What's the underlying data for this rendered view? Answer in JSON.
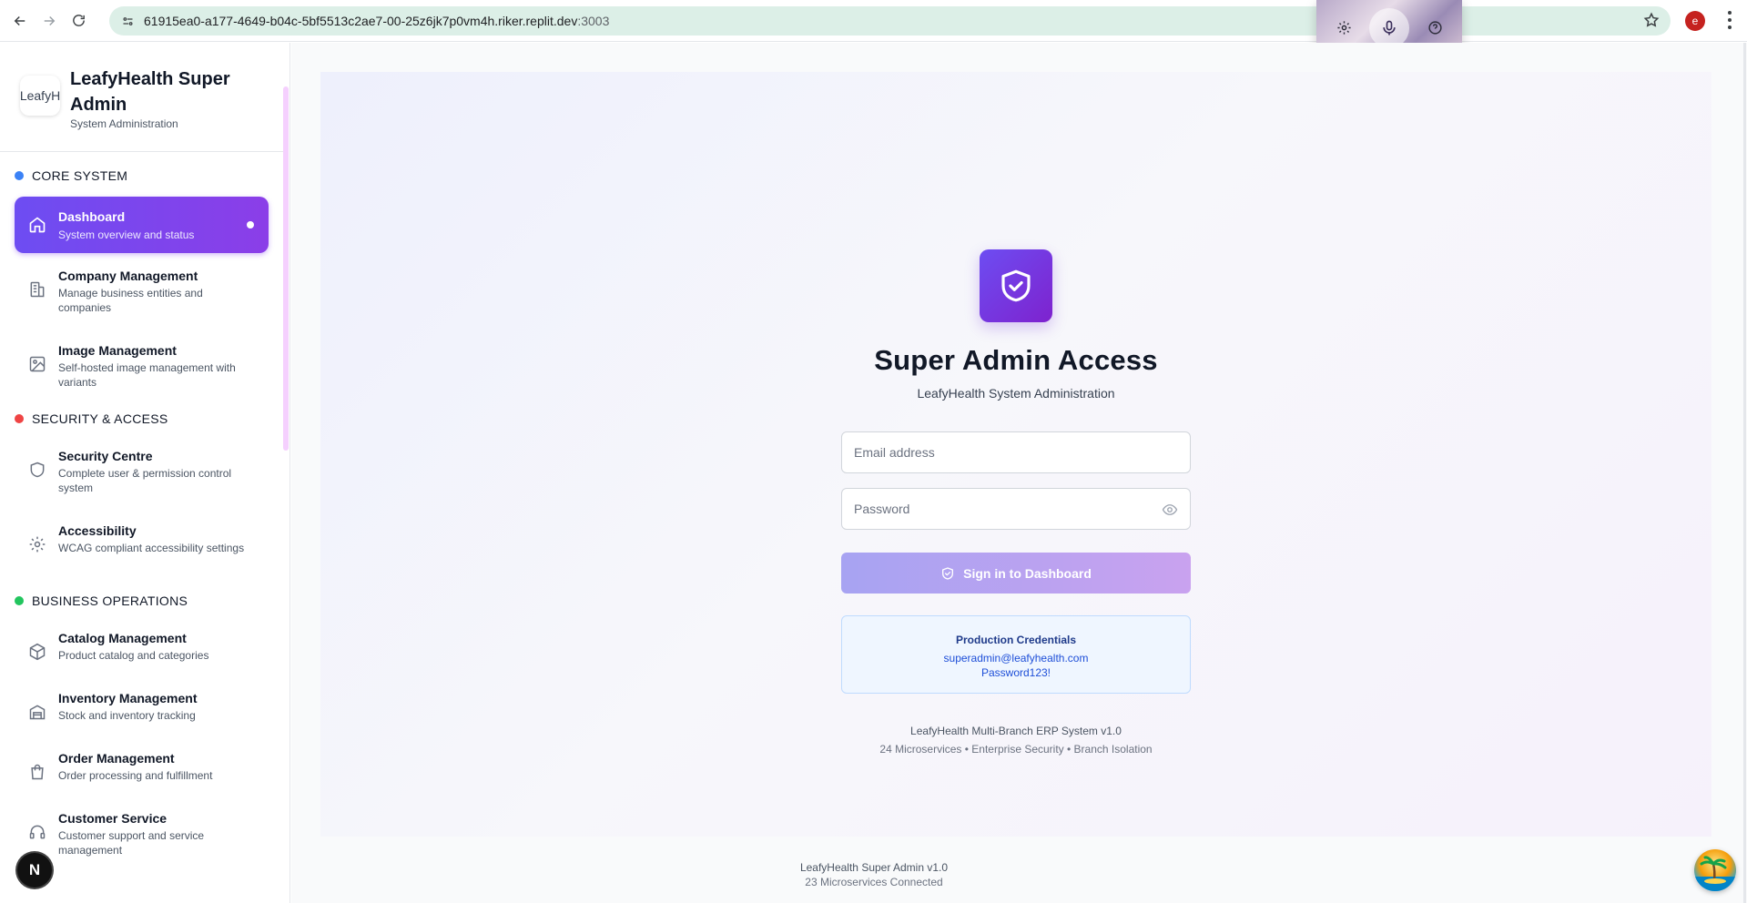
{
  "browser": {
    "url_host": "61915ea0-a177-4649-b04c-5bf5513c2ae7-00-25z6jk7p0vm4h.riker.replit.dev",
    "url_port": ":3003",
    "profile_initial": "e"
  },
  "sidebar": {
    "brand": {
      "logo_alt": "LeafyH",
      "title": "LeafyHealth Super Admin",
      "subtitle": "System Administration"
    },
    "sections": [
      {
        "label": "CORE SYSTEM",
        "color": "#3b82f6"
      },
      {
        "label": "SECURITY & ACCESS",
        "color": "#ef4444"
      },
      {
        "label": "BUSINESS OPERATIONS",
        "color": "#22c55e"
      }
    ],
    "items": [
      {
        "label": "Dashboard",
        "desc": "System overview and status",
        "icon": "home-icon",
        "active": true
      },
      {
        "label": "Company Management",
        "desc": "Manage business entities and companies",
        "icon": "building-icon"
      },
      {
        "label": "Image Management",
        "desc": "Self-hosted image management with variants",
        "icon": "image-icon"
      },
      {
        "label": "Security Centre",
        "desc": "Complete user & permission control system",
        "icon": "shield-icon"
      },
      {
        "label": "Accessibility",
        "desc": "WCAG compliant accessibility settings",
        "icon": "gear-icon"
      },
      {
        "label": "Catalog Management",
        "desc": "Product catalog and categories",
        "icon": "package-icon"
      },
      {
        "label": "Inventory Management",
        "desc": "Stock and inventory tracking",
        "icon": "warehouse-icon"
      },
      {
        "label": "Order Management",
        "desc": "Order processing and fulfillment",
        "icon": "shopping-bag-icon"
      },
      {
        "label": "Customer Service",
        "desc": "Customer support and service management",
        "icon": "headset-icon"
      }
    ]
  },
  "login": {
    "title": "Super Admin Access",
    "subtitle": "LeafyHealth System Administration",
    "email_placeholder": "Email address",
    "password_placeholder": "Password",
    "signin_label": "Sign in to Dashboard",
    "credentials": {
      "title": "Production Credentials",
      "email": "superadmin@leafyhealth.com",
      "password": "Password123!"
    },
    "footer_line1": "LeafyHealth Multi-Branch ERP System v1.0",
    "footer_line2": "24 Microservices • Enterprise Security • Branch Isolation"
  },
  "app_footer": {
    "line1": "LeafyHealth Super Admin v1.0",
    "line2": "23 Microservices Connected"
  },
  "next_badge": "N",
  "colors": {
    "accent": "#7c3aed",
    "accent_start": "#6d4df2",
    "credentials_bg": "#eff6ff"
  }
}
